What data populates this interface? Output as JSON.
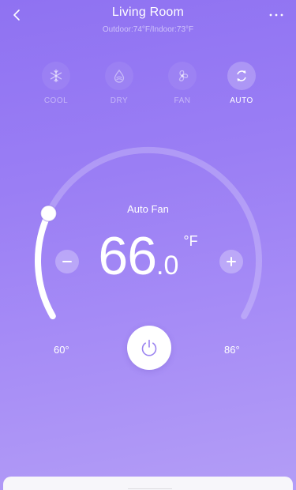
{
  "header": {
    "title": "Living Room",
    "subtitle": "Outdoor:74°F/Indoor:73°F"
  },
  "modes": [
    {
      "label": "COOL",
      "icon": "snowflake-icon",
      "active": false
    },
    {
      "label": "DRY",
      "icon": "water-drop-icon",
      "active": false
    },
    {
      "label": "FAN",
      "icon": "fan-icon",
      "active": false
    },
    {
      "label": "AUTO",
      "icon": "auto-cycle-icon",
      "active": true
    }
  ],
  "thermostat": {
    "fan_mode": "Auto Fan",
    "temp_whole": "66",
    "temp_decimal": ".0",
    "unit": "°F",
    "min_label": "60°",
    "max_label": "86°",
    "min_value": 60,
    "max_value": 86,
    "setpoint": 66.0
  },
  "colors": {
    "background_top": "#8f72f2",
    "background_bottom": "#b39df6",
    "power_icon": "#9b84f0"
  }
}
